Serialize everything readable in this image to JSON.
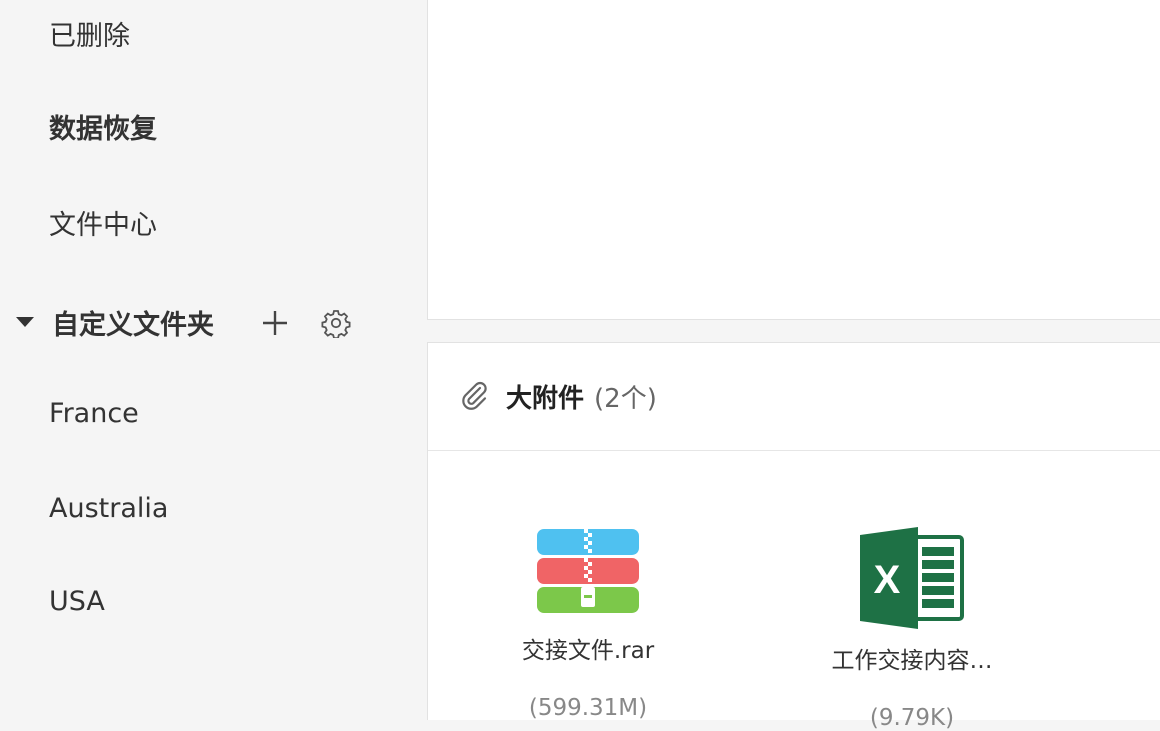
{
  "sidebar": {
    "items": [
      {
        "label": "已删除"
      },
      {
        "label": "数据恢复"
      },
      {
        "label": "文件中心"
      }
    ],
    "custom_folders": {
      "title": "自定义文件夹",
      "add_icon": "plus-icon",
      "settings_icon": "gear-icon",
      "folders": [
        {
          "label": "France"
        },
        {
          "label": "Australia"
        },
        {
          "label": "USA"
        }
      ]
    }
  },
  "attachments": {
    "title": "大附件",
    "count": "(2个)",
    "icon": "paperclip-icon",
    "files": [
      {
        "name": "交接文件.rar",
        "size": "(599.31M)",
        "icon": "rar-archive-icon"
      },
      {
        "name": "工作交接内容…",
        "size": "(9.79K)",
        "icon": "excel-file-icon"
      }
    ]
  },
  "colors": {
    "sidebar_bg": "#f5f5f5",
    "content_bg": "#ffffff",
    "excel_green": "#1e7145",
    "rar_blue": "#4fc1f0",
    "rar_red": "#f06466",
    "rar_green": "#7cc84a"
  }
}
